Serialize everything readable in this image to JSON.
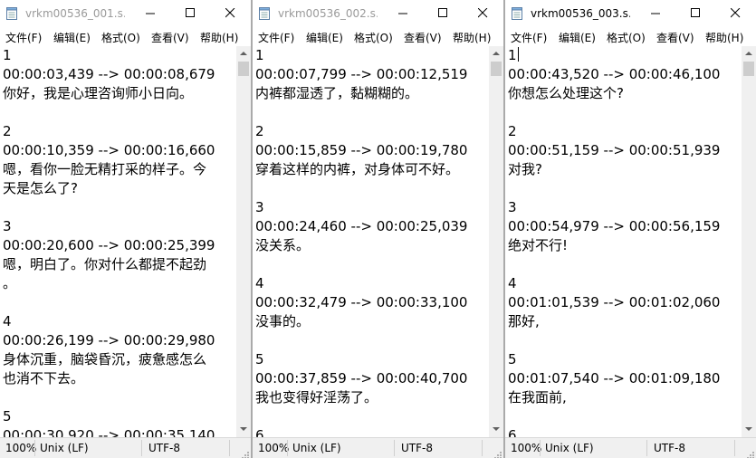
{
  "windows": [
    {
      "title": "vrkm00536_001.s…",
      "menu": [
        "文件(F)",
        "编辑(E)",
        "格式(O)",
        "查看(V)",
        "帮助(H)"
      ],
      "lines": [
        "1",
        "00:00:03,439 --> 00:00:08,679",
        "你好，我是心理咨询师小日向。",
        "",
        "2",
        "00:00:10,359 --> 00:00:16,660",
        "嗯，看你一脸无精打采的样子。今",
        "天是怎么了?",
        "",
        "3",
        "00:00:20,600 --> 00:00:25,399",
        "嗯，明白了。你对什么都提不起劲",
        "。",
        "",
        "4",
        "00:00:26,199 --> 00:00:29,980",
        "身体沉重，脑袋昏沉，疲惫感怎么",
        "也消不下去。",
        "",
        "5",
        "00:00:30,920 --> 00:00:35,140"
      ],
      "status": {
        "zoom": "100%",
        "eol": "Unix (LF)",
        "encoding": "UTF-8"
      }
    },
    {
      "title": "vrkm00536_002.s…",
      "menu": [
        "文件(F)",
        "编辑(E)",
        "格式(O)",
        "查看(V)",
        "帮助(H)"
      ],
      "lines": [
        "1",
        "00:00:07,799 --> 00:00:12,519",
        "内裤都湿透了，黏糊糊的。",
        "",
        "2",
        "00:00:15,859 --> 00:00:19,780",
        "穿着这样的内裤，对身体可不好。",
        "",
        "3",
        "00:00:24,460 --> 00:00:25,039",
        "没关系。",
        "",
        "4",
        "00:00:32,479 --> 00:00:33,100",
        "没事的。",
        "",
        "5",
        "00:00:37,859 --> 00:00:40,700",
        "我也变得好淫荡了。",
        "",
        "6"
      ],
      "status": {
        "zoom": "100%",
        "eol": "Unix (LF)",
        "encoding": "UTF-8"
      }
    },
    {
      "title": "vrkm00536_003.s…",
      "menu": [
        "文件(F)",
        "编辑(E)",
        "格式(O)",
        "查看(V)",
        "帮助(H)"
      ],
      "lines": [
        "1",
        "00:00:43,520 --> 00:00:46,100",
        "你想怎么处理这个?",
        "",
        "2",
        "00:00:51,159 --> 00:00:51,939",
        "对我?",
        "",
        "3",
        "00:00:54,979 --> 00:00:56,159",
        "绝对不行!",
        "",
        "4",
        "00:01:01,539 --> 00:01:02,060",
        "那好,",
        "",
        "5",
        "00:01:07,540 --> 00:01:09,180",
        "在我面前,",
        "",
        "6"
      ],
      "status": {
        "zoom": "100%",
        "eol": "Unix (LF)",
        "encoding": "UTF-8"
      }
    }
  ],
  "icons": {
    "app": "notepad-icon",
    "minimize": "minimize-icon",
    "maximize": "maximize-icon",
    "close": "close-icon"
  },
  "colors": {
    "title_text": "#9a9a9a",
    "statusbar_bg": "#f0f0f0",
    "scroll_thumb": "#cdcdcd"
  }
}
